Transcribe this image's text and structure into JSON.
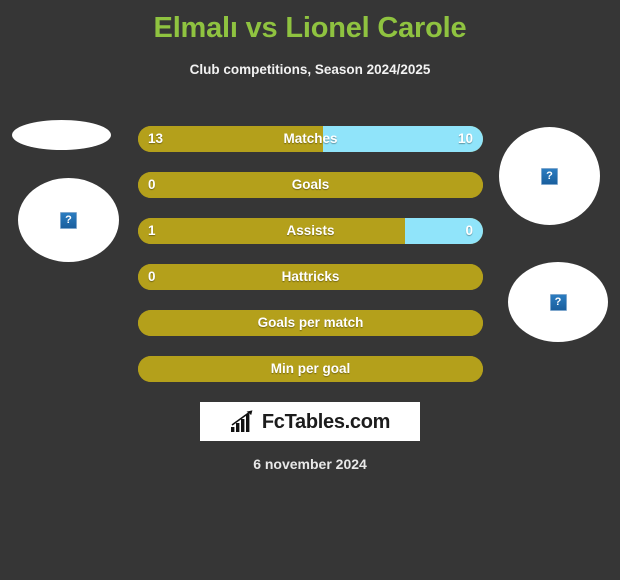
{
  "header": {
    "title": "Elmalı vs Lionel Carole",
    "subtitle": "Club competitions, Season 2024/2025"
  },
  "colors": {
    "background": "#363636",
    "title": "#8FC340",
    "home_bar": "#B4A01B",
    "away_bar": "#90E4FA",
    "label_text": "#ffffff",
    "logo_box": "#ffffff"
  },
  "chart_data": {
    "type": "bar",
    "title": "Elmalı vs Lionel Carole",
    "subtitle": "Club competitions, Season 2024/2025",
    "orientation": "horizontal",
    "style": "paired-opposing-bars",
    "legend_position": "none",
    "series": [
      {
        "name": "Elmalı",
        "side": "left",
        "color": "#B4A01B",
        "values": [
          "13",
          "0",
          "1",
          "0",
          "",
          ""
        ]
      },
      {
        "name": "Lionel Carole",
        "side": "right",
        "color": "#90E4FA",
        "values": [
          "10",
          "",
          "0",
          "",
          "",
          ""
        ]
      }
    ],
    "categories": [
      "Matches",
      "Goals",
      "Assists",
      "Hattricks",
      "Goals per match",
      "Min per goal"
    ],
    "rows": [
      {
        "label": "Matches",
        "left_value": "13",
        "right_value": "10",
        "left_pct": 53.5,
        "right_pct": 46.5
      },
      {
        "label": "Goals",
        "left_value": "0",
        "right_value": "",
        "left_pct": 100,
        "right_pct": 0
      },
      {
        "label": "Assists",
        "left_value": "1",
        "right_value": "0",
        "left_pct": 77.5,
        "right_pct": 22.5
      },
      {
        "label": "Hattricks",
        "left_value": "0",
        "right_value": "",
        "left_pct": 100,
        "right_pct": 0
      },
      {
        "label": "Goals per match",
        "left_value": "",
        "right_value": "",
        "left_pct": 100,
        "right_pct": 0
      },
      {
        "label": "Min per goal",
        "left_value": "",
        "right_value": "",
        "left_pct": 100,
        "right_pct": 0
      }
    ]
  },
  "photos": {
    "left_top": {
      "icon": "broken-image-icon",
      "glyph": ""
    },
    "left_main": {
      "icon": "broken-image-icon",
      "glyph": "?"
    },
    "right_top": {
      "icon": "broken-image-icon",
      "glyph": "?"
    },
    "right_main": {
      "icon": "broken-image-icon",
      "glyph": "?"
    }
  },
  "footer": {
    "logo_text": "FcTables.com",
    "logo_icon": "bar-chart-trend-icon",
    "date": "6 november 2024"
  }
}
